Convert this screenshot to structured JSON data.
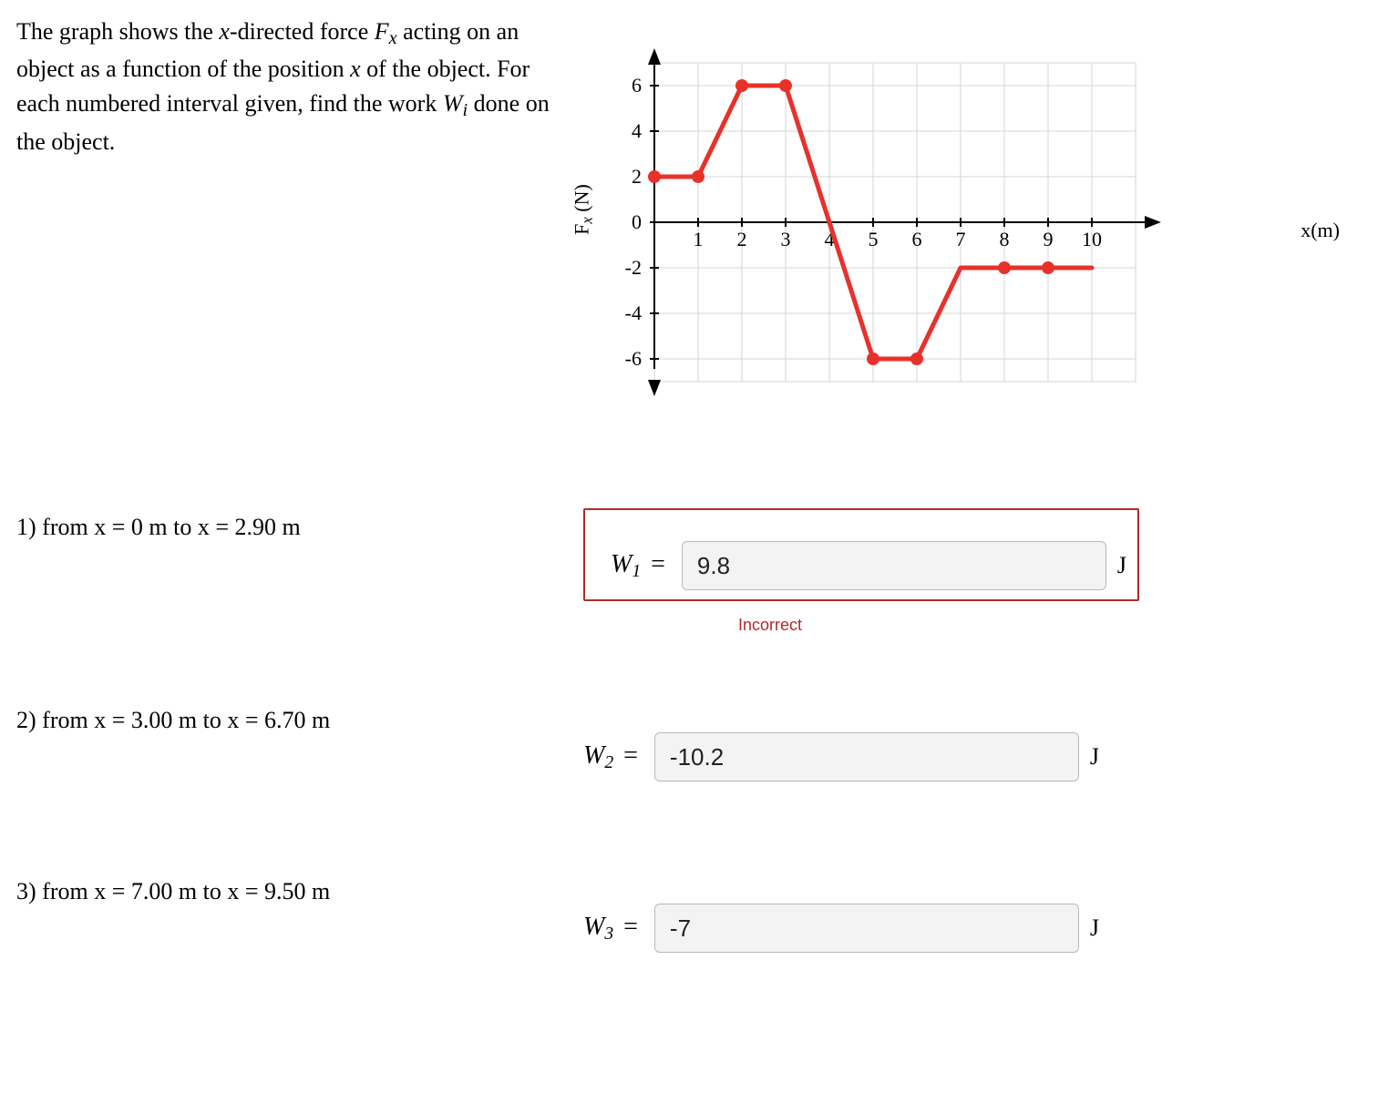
{
  "prompt_html": "The graph shows the <span class='it'>x</span>-directed force <span class='it'>F<span class='sub'>x</span></span> acting on an object as a function of the position <span class='it'>x</span> of the object. For each numbered interval given, find the work <span class='it'>W<span class='sub'>i</span></span> done on the object.",
  "axis_y_label_html": "F<span class='sub'>x</span> (N)",
  "axis_x_label_html": "<span class='it'>x</span>(m)",
  "y_ticks": [
    6,
    4,
    2,
    0,
    -2,
    -4,
    -6
  ],
  "x_ticks": [
    1,
    2,
    3,
    4,
    5,
    6,
    7,
    8,
    9,
    10
  ],
  "chart_data": {
    "type": "line",
    "x": [
      0,
      1,
      2,
      3,
      4,
      5,
      6,
      7,
      8,
      9,
      10
    ],
    "y": [
      2,
      2,
      6,
      6,
      0,
      -6,
      -6,
      -2,
      -2,
      -2,
      -2
    ],
    "xlabel": "x (m)",
    "ylabel": "Fx (N)",
    "ylim": [
      -7,
      7
    ],
    "xlim": [
      0,
      11
    ],
    "markers_at_x": [
      0,
      1,
      2,
      3,
      5,
      6,
      8,
      9
    ],
    "grid": true
  },
  "q1": {
    "text_html": "1) from <span class='it'>x</span> = 0 m to <span class='it'>x</span> = 2.90 m",
    "label_html": "W<span class='sub'>1</span> <span class='eq'>=</span>",
    "value": "9.8",
    "unit": "J",
    "status": "Incorrect"
  },
  "q2": {
    "text_html": "2) from <span class='it'>x</span> = 3.00 m to <span class='it'>x</span> = 6.70 m",
    "label_html": "W<span class='sub'>2</span> <span class='eq'>=</span>",
    "value": "-10.2",
    "unit": "J"
  },
  "q3": {
    "text_html": "3) from <span class='it'>x</span> = 7.00 m to <span class='it'>x</span> = 9.50 m",
    "label_html": "W<span class='sub'>3</span> <span class='eq'>=</span>",
    "value": "-7",
    "unit": "J"
  }
}
